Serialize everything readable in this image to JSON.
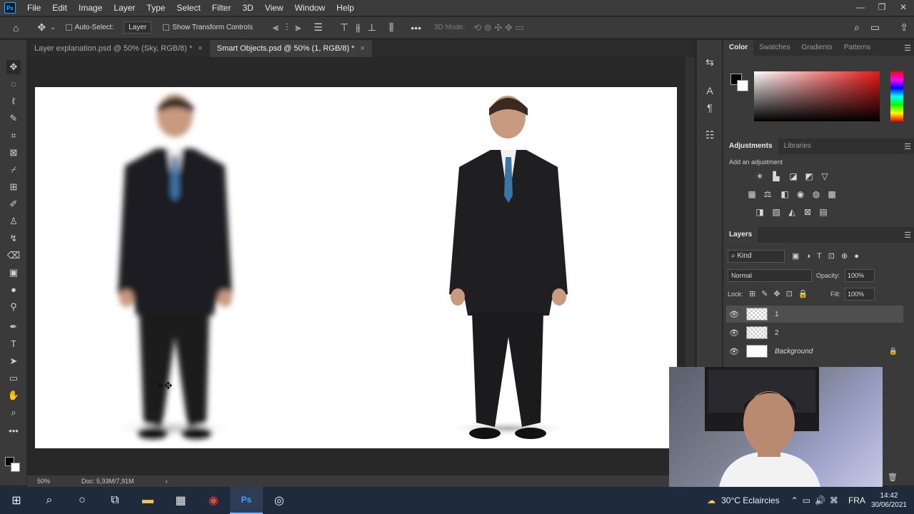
{
  "app": {
    "logo": "Ps"
  },
  "menu": [
    "File",
    "Edit",
    "Image",
    "Layer",
    "Type",
    "Select",
    "Filter",
    "3D",
    "View",
    "Window",
    "Help"
  ],
  "options": {
    "auto_select_label": "Auto-Select:",
    "auto_select_value": "Layer",
    "transform_controls_label": "Show Transform Controls",
    "mode_3d_label": "3D Mode:"
  },
  "tabs": [
    {
      "label": "Layer explanation.psd @ 50% (Sky, RGB/8) *",
      "active": false
    },
    {
      "label": "Smart Objects.psd @ 50% (1, RGB/8) *",
      "active": true
    }
  ],
  "status": {
    "zoom": "50%",
    "doc": "Doc: 5,93M/7,91M"
  },
  "panels": {
    "color_tabs": [
      "Color",
      "Swatches",
      "Gradients",
      "Patterns"
    ],
    "adjust_tabs": [
      "Adjustments",
      "Libraries"
    ],
    "add_adjustment": "Add an adjustment",
    "layers_title": "Layers",
    "kind_label": "Kind",
    "blend_mode": "Normal",
    "opacity_label": "Opacity:",
    "opacity_value": "100%",
    "lock_label": "Lock:",
    "fill_label": "Fill:",
    "fill_value": "100%",
    "layers": [
      {
        "name": "1",
        "selected": true
      },
      {
        "name": "2",
        "selected": false
      },
      {
        "name": "Background",
        "selected": false,
        "locked": true
      }
    ]
  },
  "taskbar": {
    "weather": "30°C Eclaircies",
    "language": "FRA",
    "time": "14:42",
    "date": "30/06/2021"
  },
  "colors": {
    "accent": "#31a8ff",
    "foreground": "#000000",
    "background": "#ffffff"
  }
}
